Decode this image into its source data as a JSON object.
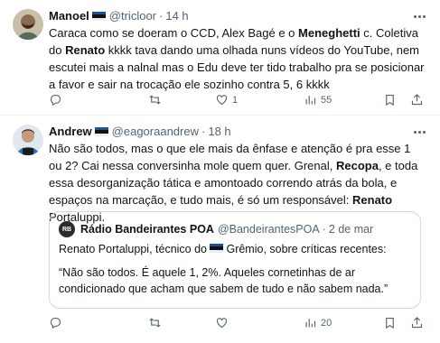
{
  "tweets": [
    {
      "author": "Manoel",
      "handle": "@tricloor",
      "time": "14 h",
      "text": [
        {
          "t": "Caraca como se doeram o CCD, Alex Bagé e o ",
          "b": false
        },
        {
          "t": "Meneghetti",
          "b": true
        },
        {
          "t": " c. Coletiva do ",
          "b": false
        },
        {
          "t": "Renato",
          "b": true
        },
        {
          "t": " kkkk tava dando uma olhada nuns vídeos do YouTube, nem escutei mais a nalnal mas o Edu deve ter tido trabalho pra se posicionar a favor e sair na trocação ele sozinho contra 5, 6 kkkk",
          "b": false
        }
      ],
      "actions": {
        "reply": "",
        "retweet": "",
        "like": "1",
        "views": "55"
      }
    },
    {
      "author": "Andrew",
      "handle": "@eagoraandrew",
      "time": "18 h",
      "text": [
        {
          "t": "Não são todos, mas o que ele mais da ênfase e atenção é pra esse 1 ou 2? Cai nessa conversinha mole quem quer. Grenal, ",
          "b": false
        },
        {
          "t": "Recopa",
          "b": true
        },
        {
          "t": ", e toda essa desorganização tática e amontoado correndo atrás da bola, e espaços na marcação, e tudo mais, é só um responsável: ",
          "b": false
        },
        {
          "t": "Renato",
          "b": true
        },
        {
          "t": " Portaluppi.",
          "b": false
        }
      ],
      "quote": {
        "avatar_text": "RB",
        "author": "Rádio Bandeirantes POA",
        "handle": "@BandeirantesPOA",
        "time": "2 de mar",
        "line1a": "Renato Portaluppi, técnico do ",
        "line1b": "Grêmio, sobre críticas recentes:",
        "line2": "“Não são todos. É aquele 1, 2%. Aqueles cornetinhas de ar condicionado que acham que sabem de tudo e não sabem nada.”"
      },
      "actions": {
        "reply": "",
        "retweet": "",
        "like": "",
        "views": "20"
      }
    }
  ],
  "separator": "·",
  "icons": [
    "reply-icon",
    "retweet-icon",
    "like-icon",
    "views-icon",
    "bookmark-icon",
    "share-icon",
    "more-icon"
  ]
}
